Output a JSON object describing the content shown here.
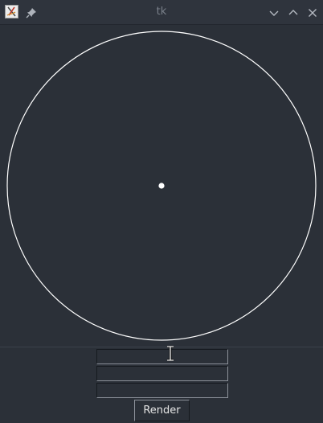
{
  "window": {
    "title": "tk",
    "icons": {
      "app": "tk-app-icon",
      "pin": "pin-icon",
      "minimize": "chevron-down-icon",
      "maximize": "chevron-up-icon",
      "close": "close-icon"
    }
  },
  "canvas": {
    "shapes": [
      "circle",
      "center-dot"
    ],
    "colors": {
      "background": "#2b3038",
      "stroke": "#ffffff"
    }
  },
  "form": {
    "field1_value": "",
    "field2_value": "",
    "field3_value": "",
    "render_label": "Render"
  }
}
